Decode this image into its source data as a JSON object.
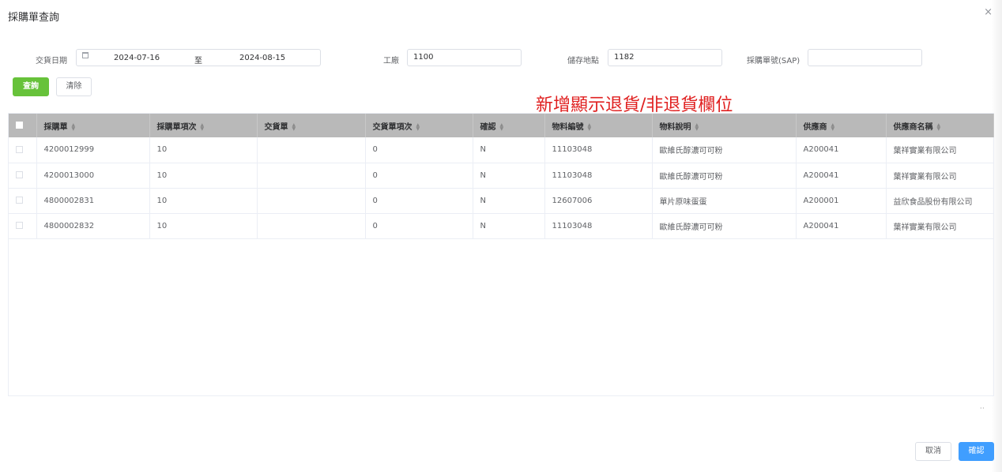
{
  "dialog": {
    "title": "採購單查詢",
    "close_icon": "×"
  },
  "filters": {
    "delivery_date_label": "交貨日期",
    "date_start": "2024-07-16",
    "date_sep": "至",
    "date_end": "2024-08-15",
    "plant_label": "工廠",
    "plant_value": "1100",
    "storage_label": "儲存地點",
    "storage_value": "1182",
    "po_sap_label": "採購單號(SAP)",
    "po_sap_value": ""
  },
  "buttons": {
    "query": "查詢",
    "clear": "清除",
    "cancel": "取消",
    "confirm": "確認"
  },
  "annotation": "新增顯示退貨/非退貨欄位",
  "table": {
    "columns": [
      "採購單",
      "採購單項次",
      "交貨單",
      "交貨單項次",
      "確認",
      "物料編號",
      "物料說明",
      "供應商",
      "供應商名稱"
    ],
    "rows": [
      [
        "4200012999",
        "10",
        "",
        "0",
        "N",
        "11103048",
        "歐維氏醇濃可可粉",
        "A200041",
        "葉祥實業有限公司"
      ],
      [
        "4200013000",
        "10",
        "",
        "0",
        "N",
        "11103048",
        "歐維氏醇濃可可粉",
        "A200041",
        "葉祥實業有限公司"
      ],
      [
        "4800002831",
        "10",
        "",
        "0",
        "N",
        "12607006",
        "單片原味蛋蛋",
        "A200001",
        "益欣食品股份有限公司"
      ],
      [
        "4800002832",
        "10",
        "",
        "0",
        "N",
        "11103048",
        "歐維氏醇濃可可粉",
        "A200041",
        "葉祥實業有限公司"
      ]
    ]
  },
  "colors": {
    "query_button": "#67c23a",
    "confirm_button": "#409eff",
    "annotation": "#e02020",
    "table_header": "#b9b9b9"
  }
}
